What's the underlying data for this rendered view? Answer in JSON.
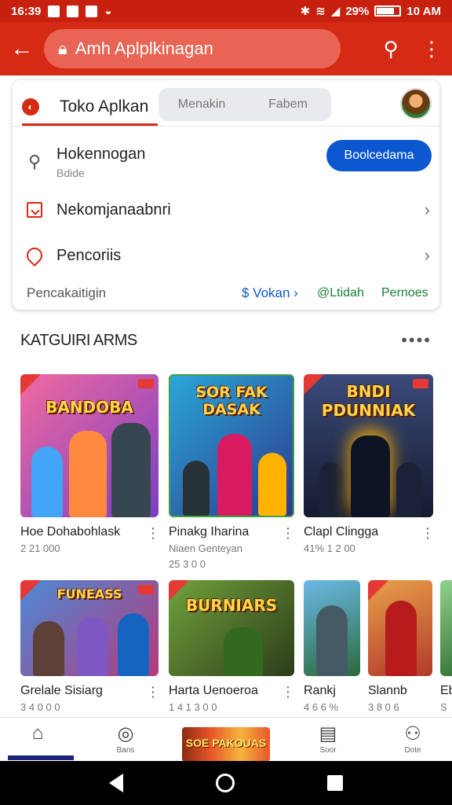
{
  "status": {
    "time": "16:39",
    "battery": "29%",
    "time_right": "10 AM"
  },
  "app_bar": {
    "url": "Amh Aplplkinagan"
  },
  "card": {
    "tab_active": "Toko Aplkan",
    "seg_left": "Menakin",
    "seg_right": "Fabem",
    "row1": {
      "title": "Hokennogan",
      "sub": "Bdide",
      "button": "Boolcedama"
    },
    "row2": {
      "title": "Nekomjanaabnri"
    },
    "row3": {
      "title": "Pencoriis"
    },
    "footer": {
      "left": "Pencakaitigin",
      "blue": "$ Vokan ›",
      "green1": "@Ltidah",
      "green2": "Pernoes"
    }
  },
  "section": {
    "title": "KATGUIRI ARMS",
    "more": "••••"
  },
  "games_row1": [
    {
      "art_title": "BANDOBA",
      "name": "Hoe Dohabohlask",
      "meta1": "2 21 000",
      "meta2": "",
      "colors": [
        "#f06aa0",
        "#7b3fc4"
      ]
    },
    {
      "art_title": "SOR FAK DASAK",
      "name": "Pinakg Iharina",
      "meta1": "Niaen Genteyan",
      "meta2": "25 3 0 0",
      "colors": [
        "#2aa6d8",
        "#2d3a8c"
      ]
    },
    {
      "art_title": "BNDI PDUNNIAK",
      "name": "Clapl Clingga",
      "meta1": "41% 1 2 00",
      "meta2": "",
      "colors": [
        "#3a4a7a",
        "#151a2e"
      ]
    }
  ],
  "games_row2": [
    {
      "art_title": "FUNEASS",
      "name": "Grelale Sisiarg",
      "meta1": "3 4 0 0 0",
      "colors": [
        "#4d8ad6",
        "#b43a7a"
      ]
    },
    {
      "art_title": "BURNIARS",
      "name": "Harta Uenoeroa",
      "meta1": "1 4 1 3 0 0",
      "colors": [
        "#6ea23a",
        "#2e3c1a"
      ]
    },
    {
      "art_title": "",
      "name": "Rankj",
      "meta1": "4 6 6 %",
      "colors": [
        "#6bb9e8",
        "#2b6a3a"
      ]
    },
    {
      "art_title": "",
      "name": "Slannb",
      "meta1": "3 8 0 6",
      "colors": [
        "#e8a04a",
        "#b23a2a"
      ]
    },
    {
      "art_title": "",
      "name": "Eb",
      "meta1": "S",
      "colors": [
        "#8fd18f",
        "#3a7a3a"
      ]
    }
  ],
  "bottom_nav": {
    "item2": "Bans",
    "banner": "SOE PAKOUAS",
    "item4": "Soor",
    "item5": "Dote"
  }
}
